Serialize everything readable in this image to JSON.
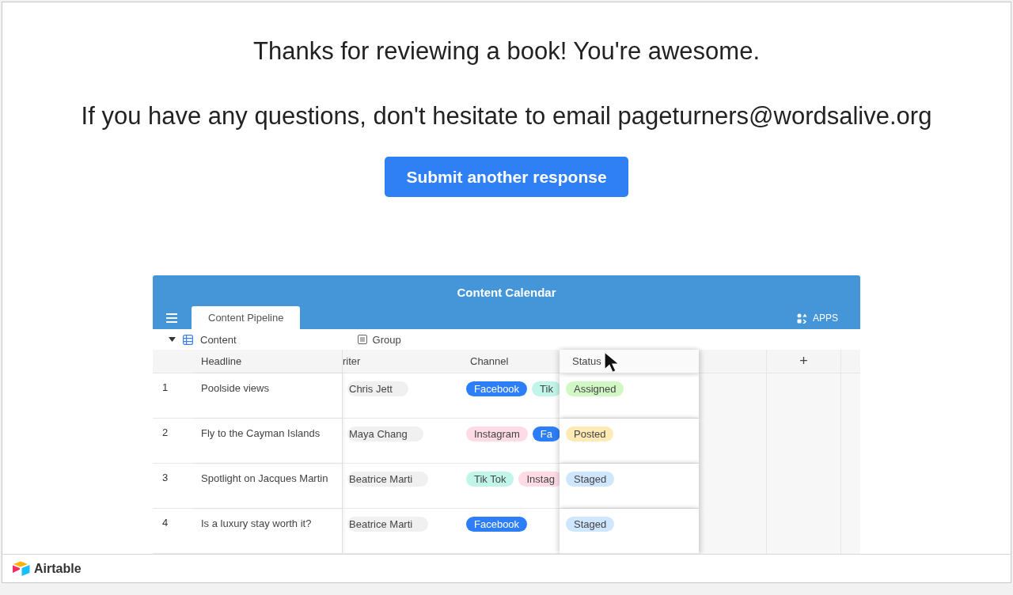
{
  "message": {
    "title": "Thanks for reviewing a book! You're awesome.",
    "body": "If you have any questions, don't hesitate to email pageturners@wordsalive.org"
  },
  "submit_button": "Submit another response",
  "embedded_app": {
    "title": "Content Calendar",
    "tabs": [
      {
        "label": "Content Pipeline",
        "selected": true
      }
    ],
    "apps_button": "APPS",
    "view": "Content",
    "group_button": "Group",
    "columns": [
      "Headline",
      "riter",
      "Channel",
      "Status"
    ],
    "add_column": "+",
    "rows": [
      {
        "number": "1",
        "headline": "Poolside views",
        "writer": "Chris Jett",
        "channels": [
          {
            "label": "Facebook",
            "color": "#2d7ff9"
          },
          {
            "label": "Tik",
            "color": "#c2f5e9"
          }
        ],
        "status": {
          "label": "Assigned",
          "color": "#d1f7c4"
        }
      },
      {
        "number": "2",
        "headline": "Fly to the Cayman Islands",
        "writer": "Maya Chang",
        "channels": [
          {
            "label": "Instagram",
            "color": "#ffdce5"
          },
          {
            "label": "Fa",
            "color": "#2d7ff9"
          }
        ],
        "status": {
          "label": "Posted",
          "color": "#ffeab6"
        }
      },
      {
        "number": "3",
        "headline": "Spotlight on Jacques Martin",
        "writer": "Beatrice Marti",
        "channels": [
          {
            "label": "Tik Tok",
            "color": "#c2f5e9"
          },
          {
            "label": "Instag",
            "color": "#ffdce5"
          }
        ],
        "status": {
          "label": "Staged",
          "color": "#cfe6ff"
        }
      },
      {
        "number": "4",
        "headline": "Is a luxury stay worth it?",
        "writer": "Beatrice Marti",
        "channels": [
          {
            "label": "Facebook",
            "color": "#2d7ff9"
          }
        ],
        "status": {
          "label": "Staged",
          "color": "#cfe6ff"
        }
      }
    ]
  },
  "footer": {
    "brand": "Airtable"
  }
}
